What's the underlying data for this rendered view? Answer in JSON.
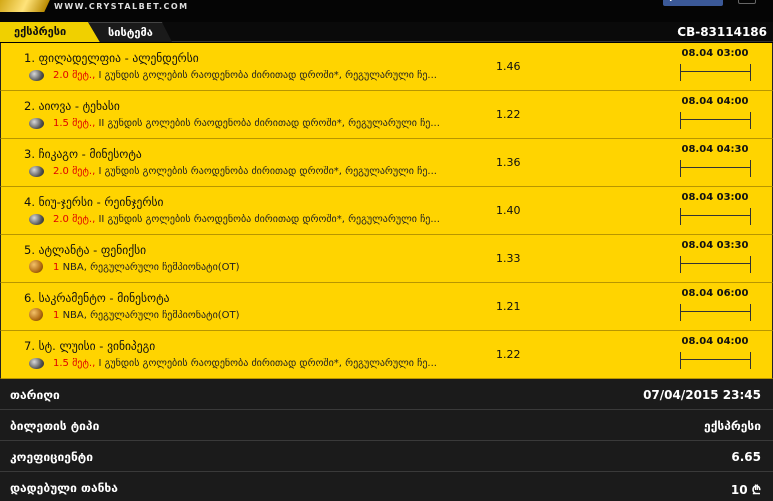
{
  "header": {
    "site_url": "WWW.CRYSTALBET.COM",
    "fb_label": "f",
    "tabs": [
      {
        "label": "ექსპრესი",
        "active": true
      },
      {
        "label": "სისტემა",
        "active": false
      }
    ],
    "ticket_id": "CB-83114186"
  },
  "events": [
    {
      "title": "1. ფილადელფია - ალენდერსი",
      "sport_icon": "hockey-puck-icon",
      "selection": "2.0 მეტ.,",
      "market": "I გუნდის გოლების რაოდენობა ძირითად დროში*, რეგულარული ჩე...",
      "odds": "1.46",
      "time": "08.04 03:00"
    },
    {
      "title": "2. აიოვა - ტეხასი",
      "sport_icon": "hockey-puck-icon",
      "selection": "1.5 მეტ.,",
      "market": "II გუნდის გოლების რაოდენობა ძირითად დროში*, რეგულარული ჩე...",
      "odds": "1.22",
      "time": "08.04 04:00"
    },
    {
      "title": "3. ჩიკაგო - მინესოტა",
      "sport_icon": "hockey-puck-icon",
      "selection": "2.0 მეტ.,",
      "market": "I გუნდის გოლების რაოდენობა ძირითად დროში*, რეგულარული ჩე...",
      "odds": "1.36",
      "time": "08.04 04:30"
    },
    {
      "title": "4. ნიუ-ჯერსი - რეინჯერსი",
      "sport_icon": "hockey-puck-icon",
      "selection": "2.0 მეტ.,",
      "market": "II გუნდის გოლების რაოდენობა ძირითად დროში*, რეგულარული ჩე...",
      "odds": "1.40",
      "time": "08.04 03:00"
    },
    {
      "title": "5. ატლანტა - ფენიქსი",
      "sport_icon": "basketball-icon",
      "selection": "1",
      "market": "NBA, რეგულარული ჩემპიონატი(OT)",
      "odds": "1.33",
      "time": "08.04 03:30"
    },
    {
      "title": "6. საკრამენტო - მინესოტა",
      "sport_icon": "basketball-icon",
      "selection": "1",
      "market": "NBA, რეგულარული ჩემპიონატი(OT)",
      "odds": "1.21",
      "time": "08.04 06:00"
    },
    {
      "title": "7. სტ. ლუისი - ვინიპეგი",
      "sport_icon": "hockey-puck-icon",
      "selection": "1.5 მეტ.,",
      "market": "I გუნდის გოლების რაოდენობა ძირითად დროში*, რეგულარული ჩე...",
      "odds": "1.22",
      "time": "08.04 04:00"
    }
  ],
  "summary": {
    "date_label": "თარიღი",
    "date_value": "07/04/2015 23:45",
    "type_label": "ბილეთის ტიპი",
    "type_value": "ექსპრესი",
    "coef_label": "კოეფიციენტი",
    "coef_value": "6.65",
    "stake_label": "დადებული თანხა",
    "stake_value": "10 ₾"
  },
  "colors": {
    "accent": "#ffd400",
    "highlight": "#e00000",
    "background": "#000000"
  }
}
